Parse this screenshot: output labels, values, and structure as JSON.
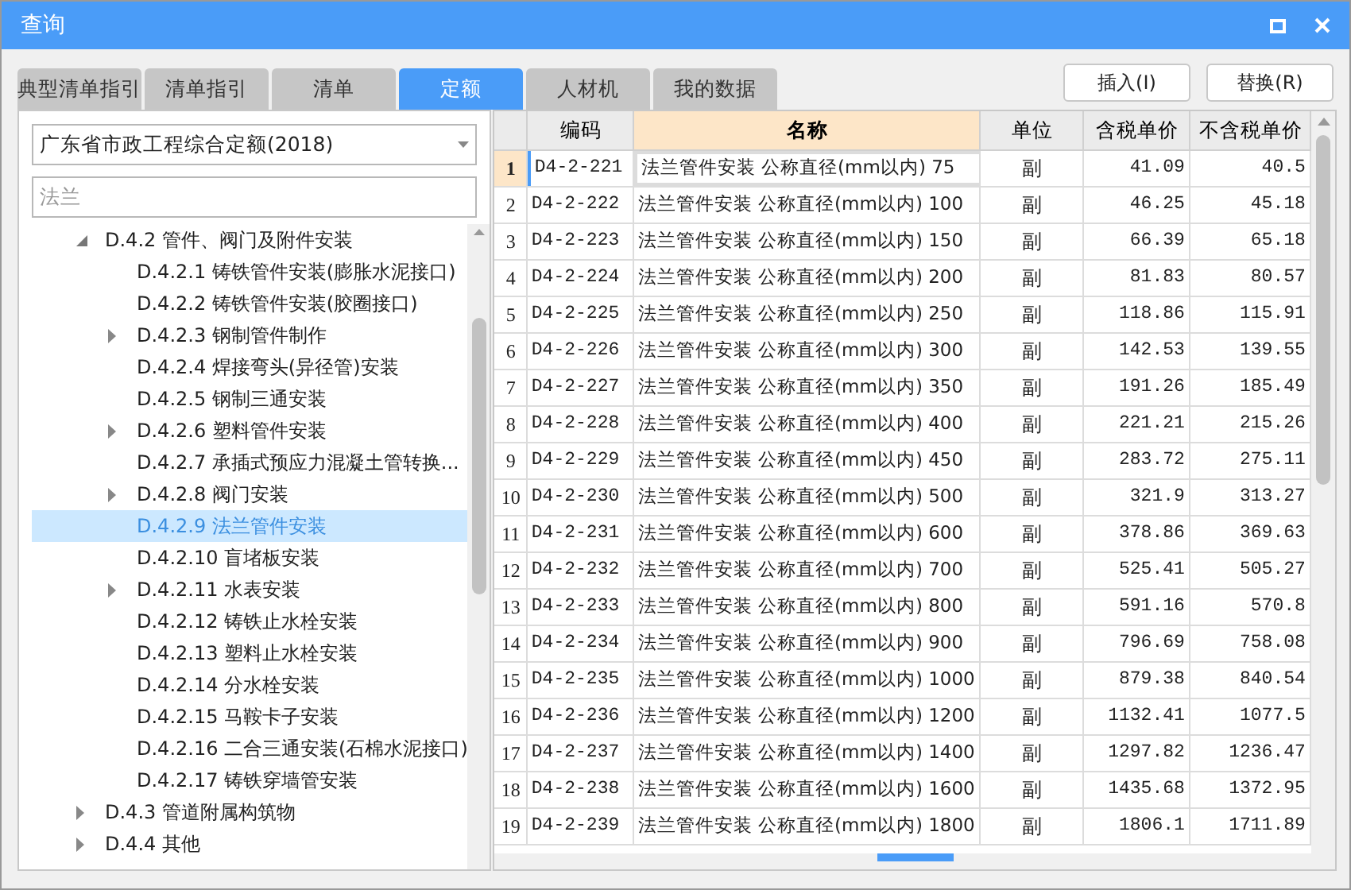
{
  "window": {
    "title": "查询"
  },
  "tabs": [
    {
      "label": "典型清单指引",
      "selected": false
    },
    {
      "label": "清单指引",
      "selected": false
    },
    {
      "label": "清单",
      "selected": false
    },
    {
      "label": "定额",
      "selected": true
    },
    {
      "label": "人材机",
      "selected": false
    },
    {
      "label": "我的数据",
      "selected": false
    }
  ],
  "buttons": [
    "插入(I)",
    "替换(R)"
  ],
  "library_select": {
    "value": "广东省市政工程综合定额(2018)"
  },
  "search": {
    "value": "法兰"
  },
  "tree": [
    {
      "label": "D.4.2 管件、阀门及附件安装",
      "expanded": true,
      "selected": false,
      "children": [
        {
          "label": "D.4.2.1 铸铁管件安装(膨胀水泥接口)",
          "selected": false
        },
        {
          "label": "D.4.2.2 铸铁管件安装(胶圈接口)",
          "selected": false
        },
        {
          "label": "D.4.2.3 钢制管件制作",
          "expanded": false,
          "selected": false
        },
        {
          "label": "D.4.2.4 焊接弯头(异径管)安装",
          "selected": false
        },
        {
          "label": "D.4.2.5 钢制三通安装",
          "selected": false
        },
        {
          "label": "D.4.2.6 塑料管件安装",
          "expanded": false,
          "selected": false
        },
        {
          "label": "D.4.2.7 承插式预应力混凝土管转换...",
          "selected": false
        },
        {
          "label": "D.4.2.8 阀门安装",
          "expanded": false,
          "selected": false
        },
        {
          "label": "D.4.2.9 法兰管件安装",
          "selected": true
        },
        {
          "label": "D.4.2.10 盲堵板安装",
          "selected": false
        },
        {
          "label": "D.4.2.11 水表安装",
          "expanded": false,
          "selected": false
        },
        {
          "label": "D.4.2.12 铸铁止水栓安装",
          "selected": false
        },
        {
          "label": "D.4.2.13 塑料止水栓安装",
          "selected": false
        },
        {
          "label": "D.4.2.14 分水栓安装",
          "selected": false
        },
        {
          "label": "D.4.2.15 马鞍卡子安装",
          "selected": false
        },
        {
          "label": "D.4.2.16 二合三通安装(石棉水泥接口)",
          "selected": false
        },
        {
          "label": "D.4.2.17 铸铁穿墙管安装",
          "selected": false
        }
      ]
    },
    {
      "label": "D.4.3 管道附属构筑物",
      "expanded": false,
      "selected": false
    },
    {
      "label": "D.4.4 其他",
      "expanded": false,
      "selected": false
    }
  ],
  "table": {
    "columns": [
      "编码",
      "名称",
      "单位",
      "含税单价",
      "不含税单价"
    ],
    "rows": [
      {
        "index": "1",
        "code": "D4-2-221",
        "name": "法兰管件安装 公称直径(mm以内) 75",
        "unit": "副",
        "price_tax": "41.09",
        "price_notax": "40.5",
        "selected": true
      },
      {
        "index": "2",
        "code": "D4-2-222",
        "name": "法兰管件安装 公称直径(mm以内) 100",
        "unit": "副",
        "price_tax": "46.25",
        "price_notax": "45.18",
        "selected": false
      },
      {
        "index": "3",
        "code": "D4-2-223",
        "name": "法兰管件安装 公称直径(mm以内) 150",
        "unit": "副",
        "price_tax": "66.39",
        "price_notax": "65.18",
        "selected": false
      },
      {
        "index": "4",
        "code": "D4-2-224",
        "name": "法兰管件安装 公称直径(mm以内) 200",
        "unit": "副",
        "price_tax": "81.83",
        "price_notax": "80.57",
        "selected": false
      },
      {
        "index": "5",
        "code": "D4-2-225",
        "name": "法兰管件安装 公称直径(mm以内) 250",
        "unit": "副",
        "price_tax": "118.86",
        "price_notax": "115.91",
        "selected": false
      },
      {
        "index": "6",
        "code": "D4-2-226",
        "name": "法兰管件安装 公称直径(mm以内) 300",
        "unit": "副",
        "price_tax": "142.53",
        "price_notax": "139.55",
        "selected": false
      },
      {
        "index": "7",
        "code": "D4-2-227",
        "name": "法兰管件安装 公称直径(mm以内) 350",
        "unit": "副",
        "price_tax": "191.26",
        "price_notax": "185.49",
        "selected": false
      },
      {
        "index": "8",
        "code": "D4-2-228",
        "name": "法兰管件安装 公称直径(mm以内) 400",
        "unit": "副",
        "price_tax": "221.21",
        "price_notax": "215.26",
        "selected": false
      },
      {
        "index": "9",
        "code": "D4-2-229",
        "name": "法兰管件安装 公称直径(mm以内) 450",
        "unit": "副",
        "price_tax": "283.72",
        "price_notax": "275.11",
        "selected": false
      },
      {
        "index": "10",
        "code": "D4-2-230",
        "name": "法兰管件安装 公称直径(mm以内) 500",
        "unit": "副",
        "price_tax": "321.9",
        "price_notax": "313.27",
        "selected": false
      },
      {
        "index": "11",
        "code": "D4-2-231",
        "name": "法兰管件安装 公称直径(mm以内) 600",
        "unit": "副",
        "price_tax": "378.86",
        "price_notax": "369.63",
        "selected": false
      },
      {
        "index": "12",
        "code": "D4-2-232",
        "name": "法兰管件安装 公称直径(mm以内) 700",
        "unit": "副",
        "price_tax": "525.41",
        "price_notax": "505.27",
        "selected": false
      },
      {
        "index": "13",
        "code": "D4-2-233",
        "name": "法兰管件安装 公称直径(mm以内) 800",
        "unit": "副",
        "price_tax": "591.16",
        "price_notax": "570.8",
        "selected": false
      },
      {
        "index": "14",
        "code": "D4-2-234",
        "name": "法兰管件安装 公称直径(mm以内) 900",
        "unit": "副",
        "price_tax": "796.69",
        "price_notax": "758.08",
        "selected": false
      },
      {
        "index": "15",
        "code": "D4-2-235",
        "name": "法兰管件安装 公称直径(mm以内) 1000",
        "unit": "副",
        "price_tax": "879.38",
        "price_notax": "840.54",
        "selected": false
      },
      {
        "index": "16",
        "code": "D4-2-236",
        "name": "法兰管件安装 公称直径(mm以内) 1200",
        "unit": "副",
        "price_tax": "1132.41",
        "price_notax": "1077.5",
        "selected": false
      },
      {
        "index": "17",
        "code": "D4-2-237",
        "name": "法兰管件安装 公称直径(mm以内) 1400",
        "unit": "副",
        "price_tax": "1297.82",
        "price_notax": "1236.47",
        "selected": false
      },
      {
        "index": "18",
        "code": "D4-2-238",
        "name": "法兰管件安装 公称直径(mm以内) 1600",
        "unit": "副",
        "price_tax": "1435.68",
        "price_notax": "1372.95",
        "selected": false
      },
      {
        "index": "19",
        "code": "D4-2-239",
        "name": "法兰管件安装 公称直径(mm以内) 1800",
        "unit": "副",
        "price_tax": "1806.1",
        "price_notax": "1711.89",
        "selected": false
      }
    ]
  }
}
